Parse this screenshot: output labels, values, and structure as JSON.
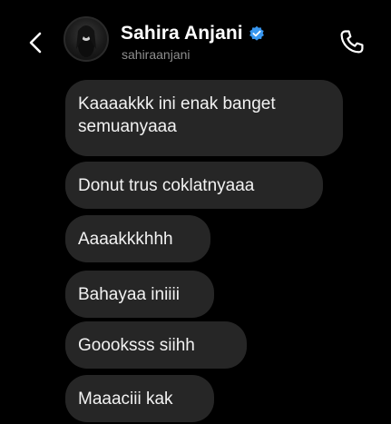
{
  "header": {
    "display_name": "Sahira Anjani",
    "username": "sahiraanjani",
    "verified": true,
    "back_icon": "chevron-left-icon",
    "call_icon": "phone-icon",
    "verified_icon": "verified-badge-icon",
    "verified_color": "#3897f0"
  },
  "messages": [
    {
      "text": "Kaaaakkk ini enak banget semuanyaaa"
    },
    {
      "text": "Donut trus coklatnyaaa"
    },
    {
      "text": "Aaaakkkhhh"
    },
    {
      "text": "Bahayaa iniiii"
    },
    {
      "text": "Goooksss siihh"
    },
    {
      "text": "Maaaciii kak"
    }
  ],
  "colors": {
    "background": "#000000",
    "bubble": "#262626",
    "text": "#f2f2f2",
    "muted": "#8e8e8e"
  }
}
